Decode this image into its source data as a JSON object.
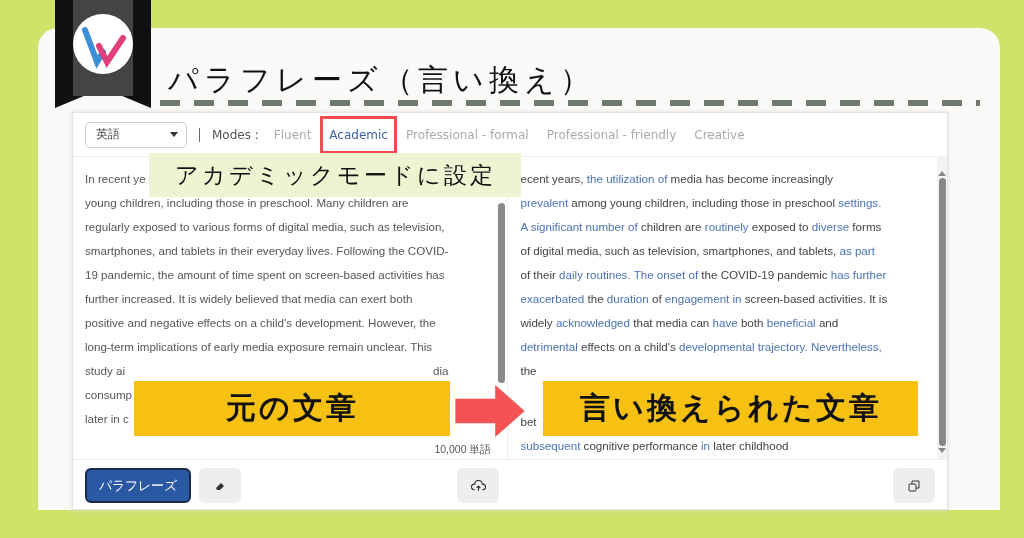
{
  "header": {
    "title": "パラフレーズ（言い換え）"
  },
  "toolbar": {
    "language": "英語",
    "modes_label": "Modes :",
    "modes": [
      {
        "label": "Fluent",
        "selected": false
      },
      {
        "label": "Academic",
        "selected": true
      },
      {
        "label": "Professional - formal",
        "selected": false
      },
      {
        "label": "Professional - friendly",
        "selected": false
      },
      {
        "label": "Creative",
        "selected": false
      }
    ]
  },
  "source_pane": {
    "lines": [
      [
        "In recent ye"
      ],
      [
        "young children, including those in preschool. Many children are"
      ],
      [
        "regularly exposed to various forms of digital media, such as television,"
      ],
      [
        "smartphones, and tablets in their everyday lives. Following the COVID-"
      ],
      [
        "19 pandemic, the amount of time spent on screen-based activities has"
      ],
      [
        "further increased. It is widely believed that media can exert both"
      ],
      [
        "positive and negative effects on a child's development. However, the"
      ],
      [
        "long-term implications of early media exposure remain unclear. This"
      ],
      [
        "study ai",
        "dia"
      ],
      [
        "consump"
      ],
      [
        "later in c"
      ]
    ],
    "word_count": "10,000 単語"
  },
  "output_pane": {
    "lines": [
      [
        {
          "text": "ecent years, ",
          "changed": false
        },
        {
          "text": "the utilization of",
          "changed": true
        },
        {
          "text": " media has become increasingly",
          "changed": false
        }
      ],
      [
        {
          "text": "prevalent",
          "changed": true
        },
        {
          "text": " among young children, including those in preschool ",
          "changed": false
        },
        {
          "text": "settings.",
          "changed": true
        }
      ],
      [
        {
          "text": "A significant number of",
          "changed": true
        },
        {
          "text": " children are ",
          "changed": false
        },
        {
          "text": "routinely",
          "changed": true
        },
        {
          "text": " exposed to ",
          "changed": false
        },
        {
          "text": "diverse",
          "changed": true
        },
        {
          "text": " forms",
          "changed": false
        }
      ],
      [
        {
          "text": "of digital media, such as television, smartphones, and tablets, ",
          "changed": false
        },
        {
          "text": "as part",
          "changed": true
        }
      ],
      [
        {
          "text": "of their ",
          "changed": false
        },
        {
          "text": "daily routines. The onset of",
          "changed": true
        },
        {
          "text": " the COVID-19 pandemic ",
          "changed": false
        },
        {
          "text": "has further",
          "changed": true
        }
      ],
      [
        {
          "text": "exacerbated",
          "changed": true
        },
        {
          "text": " the ",
          "changed": false
        },
        {
          "text": "duration",
          "changed": true
        },
        {
          "text": " of ",
          "changed": false
        },
        {
          "text": "engagement in",
          "changed": true
        },
        {
          "text": " screen-based activities. It is",
          "changed": false
        }
      ],
      [
        {
          "text": "widely ",
          "changed": false
        },
        {
          "text": "acknowledged",
          "changed": true
        },
        {
          "text": " that media can ",
          "changed": false
        },
        {
          "text": "have",
          "changed": true
        },
        {
          "text": " both ",
          "changed": false
        },
        {
          "text": "beneficial",
          "changed": true
        },
        {
          "text": " and",
          "changed": false
        }
      ],
      [
        {
          "text": "detrimental",
          "changed": true
        },
        {
          "text": " effects on a child's ",
          "changed": false
        },
        {
          "text": "developmental trajectory. Nevertheless,",
          "changed": true
        }
      ],
      [
        {
          "text": "the",
          "changed": false
        }
      ]
    ],
    "tail_lines": [
      [
        {
          "text": "bet",
          "changed": false
        }
      ],
      [
        {
          "text": "subsequent",
          "changed": true
        },
        {
          "text": " cognitive performance ",
          "changed": false
        },
        {
          "text": "in",
          "changed": true
        },
        {
          "text": " later childhood",
          "changed": false
        }
      ]
    ]
  },
  "buttons": {
    "paraphrase": "パラフレーズ"
  },
  "annotations": {
    "mode_callout": "アカデミックモードに設定",
    "source_label": "元の文章",
    "output_label": "言い換えられた文章"
  }
}
